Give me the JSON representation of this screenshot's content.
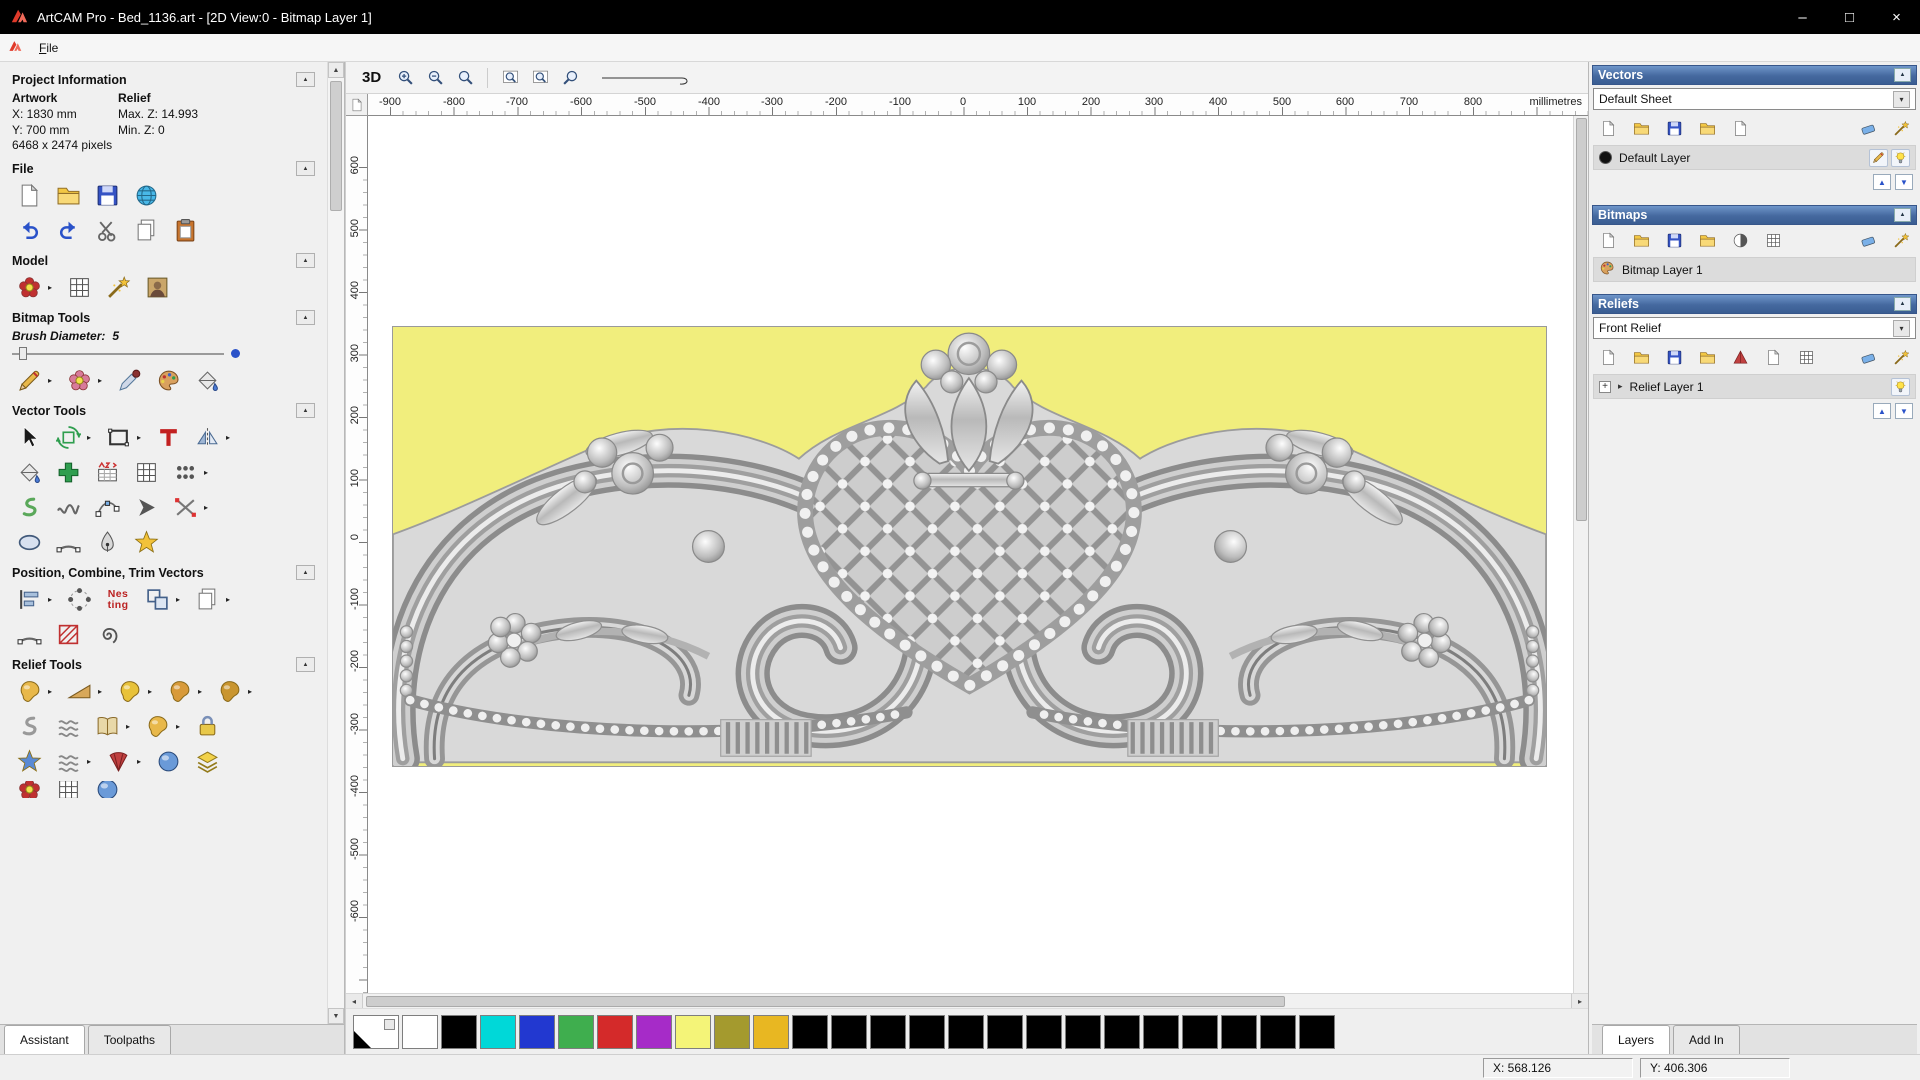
{
  "window": {
    "title": "ArtCAM Pro - Bed_1136.art - [2D View:0 - Bitmap Layer 1]",
    "buttons": {
      "minimize": "–",
      "maximize": "□",
      "close": "×"
    }
  },
  "menu": {
    "file_mnemonic": "F",
    "file_rest": "ile"
  },
  "glyphs": {
    "collapse": "▲",
    "flyout": "▸",
    "up": "▲",
    "down": "▼",
    "left": "◂",
    "right": "▸",
    "select": "▾",
    "plus": "+",
    "expander": "▸"
  },
  "assistant": {
    "project_information": {
      "title": "Project Information",
      "artwork_heading": "Artwork",
      "relief_heading": "Relief",
      "artwork_x": "X: 1830 mm",
      "artwork_y": "Y: 700 mm",
      "artwork_pixels": "6468 x 2474 pixels",
      "relief_max_z": "Max. Z: 14.993",
      "relief_min_z": "Min. Z: 0"
    },
    "sections": {
      "file": "File",
      "model": "Model",
      "bitmap_tools": "Bitmap Tools",
      "vector_tools": "Vector Tools",
      "position_combine_trim": "Position, Combine, Trim Vectors",
      "relief_tools": "Relief Tools"
    },
    "brush": {
      "label": "Brush Diameter:",
      "value": "5"
    },
    "nesting": {
      "top": "Nes",
      "bottom": "ting"
    },
    "tabs": {
      "assistant": "Assistant",
      "toolpaths": "Toolpaths"
    }
  },
  "viewport": {
    "toolbar": {
      "view_3d": "3D"
    },
    "ruler": {
      "unit": "millimetres",
      "h_labels": [
        "-900",
        "-800",
        "-700",
        "-600",
        "-500",
        "-400",
        "-300",
        "-200",
        "-100",
        "0",
        "100",
        "200",
        "300",
        "400",
        "500",
        "600",
        "700",
        "800"
      ],
      "v_labels": [
        "600",
        "500",
        "400",
        "300",
        "200",
        "100",
        "0",
        "-100",
        "-200",
        "-300",
        "-400",
        "-500",
        "-600"
      ]
    },
    "canvas_background": "#f1ee7d"
  },
  "palette": {
    "colors": [
      "#ffffff",
      "#ffffff",
      "#000000",
      "#00d8d8",
      "#2238d0",
      "#3fae4e",
      "#d42a2a",
      "#a62bc8",
      "#f4f478",
      "#a49a2e",
      "#e8b722",
      "#000000",
      "#000000",
      "#000000",
      "#000000",
      "#000000",
      "#000000",
      "#000000",
      "#000000",
      "#000000",
      "#000000",
      "#000000",
      "#000000",
      "#000000",
      "#000000"
    ]
  },
  "panels": {
    "vectors": {
      "title": "Vectors",
      "sheet": "Default Sheet",
      "layer": "Default Layer"
    },
    "bitmaps": {
      "title": "Bitmaps",
      "layer": "Bitmap Layer 1"
    },
    "reliefs": {
      "title": "Reliefs",
      "set": "Front Relief",
      "layer": "Relief Layer 1"
    },
    "tabs": {
      "layers": "Layers",
      "add_in": "Add In"
    }
  },
  "status": {
    "x": "X: 568.126",
    "y": "Y: 406.306"
  }
}
